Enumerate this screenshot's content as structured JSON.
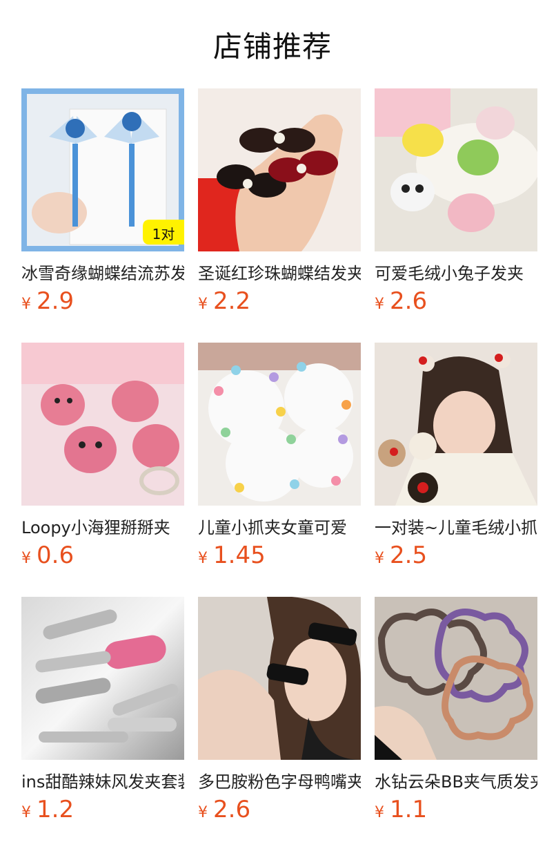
{
  "header": {
    "title": "店铺推荐"
  },
  "products": [
    {
      "name": "冰雪奇缘蝴蝶结流苏发夹",
      "currency": "¥",
      "price": "2.9",
      "badge": "1对",
      "icon": "frozen-bow-tassel-clips"
    },
    {
      "name": "圣诞红珍珠蝴蝶结发夹",
      "currency": "¥",
      "price": "2.2",
      "icon": "velvet-pearl-bow-clips"
    },
    {
      "name": "可爱毛绒小兔子发夹",
      "currency": "¥",
      "price": "2.6",
      "icon": "plush-animal-clips"
    },
    {
      "name": "Loopy小海狸掰掰夹",
      "currency": "¥",
      "price": "0.6",
      "icon": "pink-beaver-clips"
    },
    {
      "name": "儿童小抓夹女童可爱",
      "currency": "¥",
      "price": "1.45",
      "icon": "mini-claw-clips"
    },
    {
      "name": "一对装~儿童毛绒小抓夹",
      "currency": "¥",
      "price": "2.5",
      "icon": "cherry-pompom-clips"
    },
    {
      "name": "ins甜酷辣妹风发夹套装",
      "currency": "¥",
      "price": "1.2",
      "icon": "silver-letter-clips"
    },
    {
      "name": "多巴胺粉色字母鸭嘴夹",
      "currency": "¥",
      "price": "2.6",
      "icon": "barbie-duckbill-clips"
    },
    {
      "name": "水钻云朵BB夹气质发夹",
      "currency": "¥",
      "price": "1.1",
      "icon": "rhinestone-cloud-bb-clips"
    }
  ],
  "colors": {
    "price": "#e8501e",
    "title": "#111111",
    "name": "#222222"
  }
}
